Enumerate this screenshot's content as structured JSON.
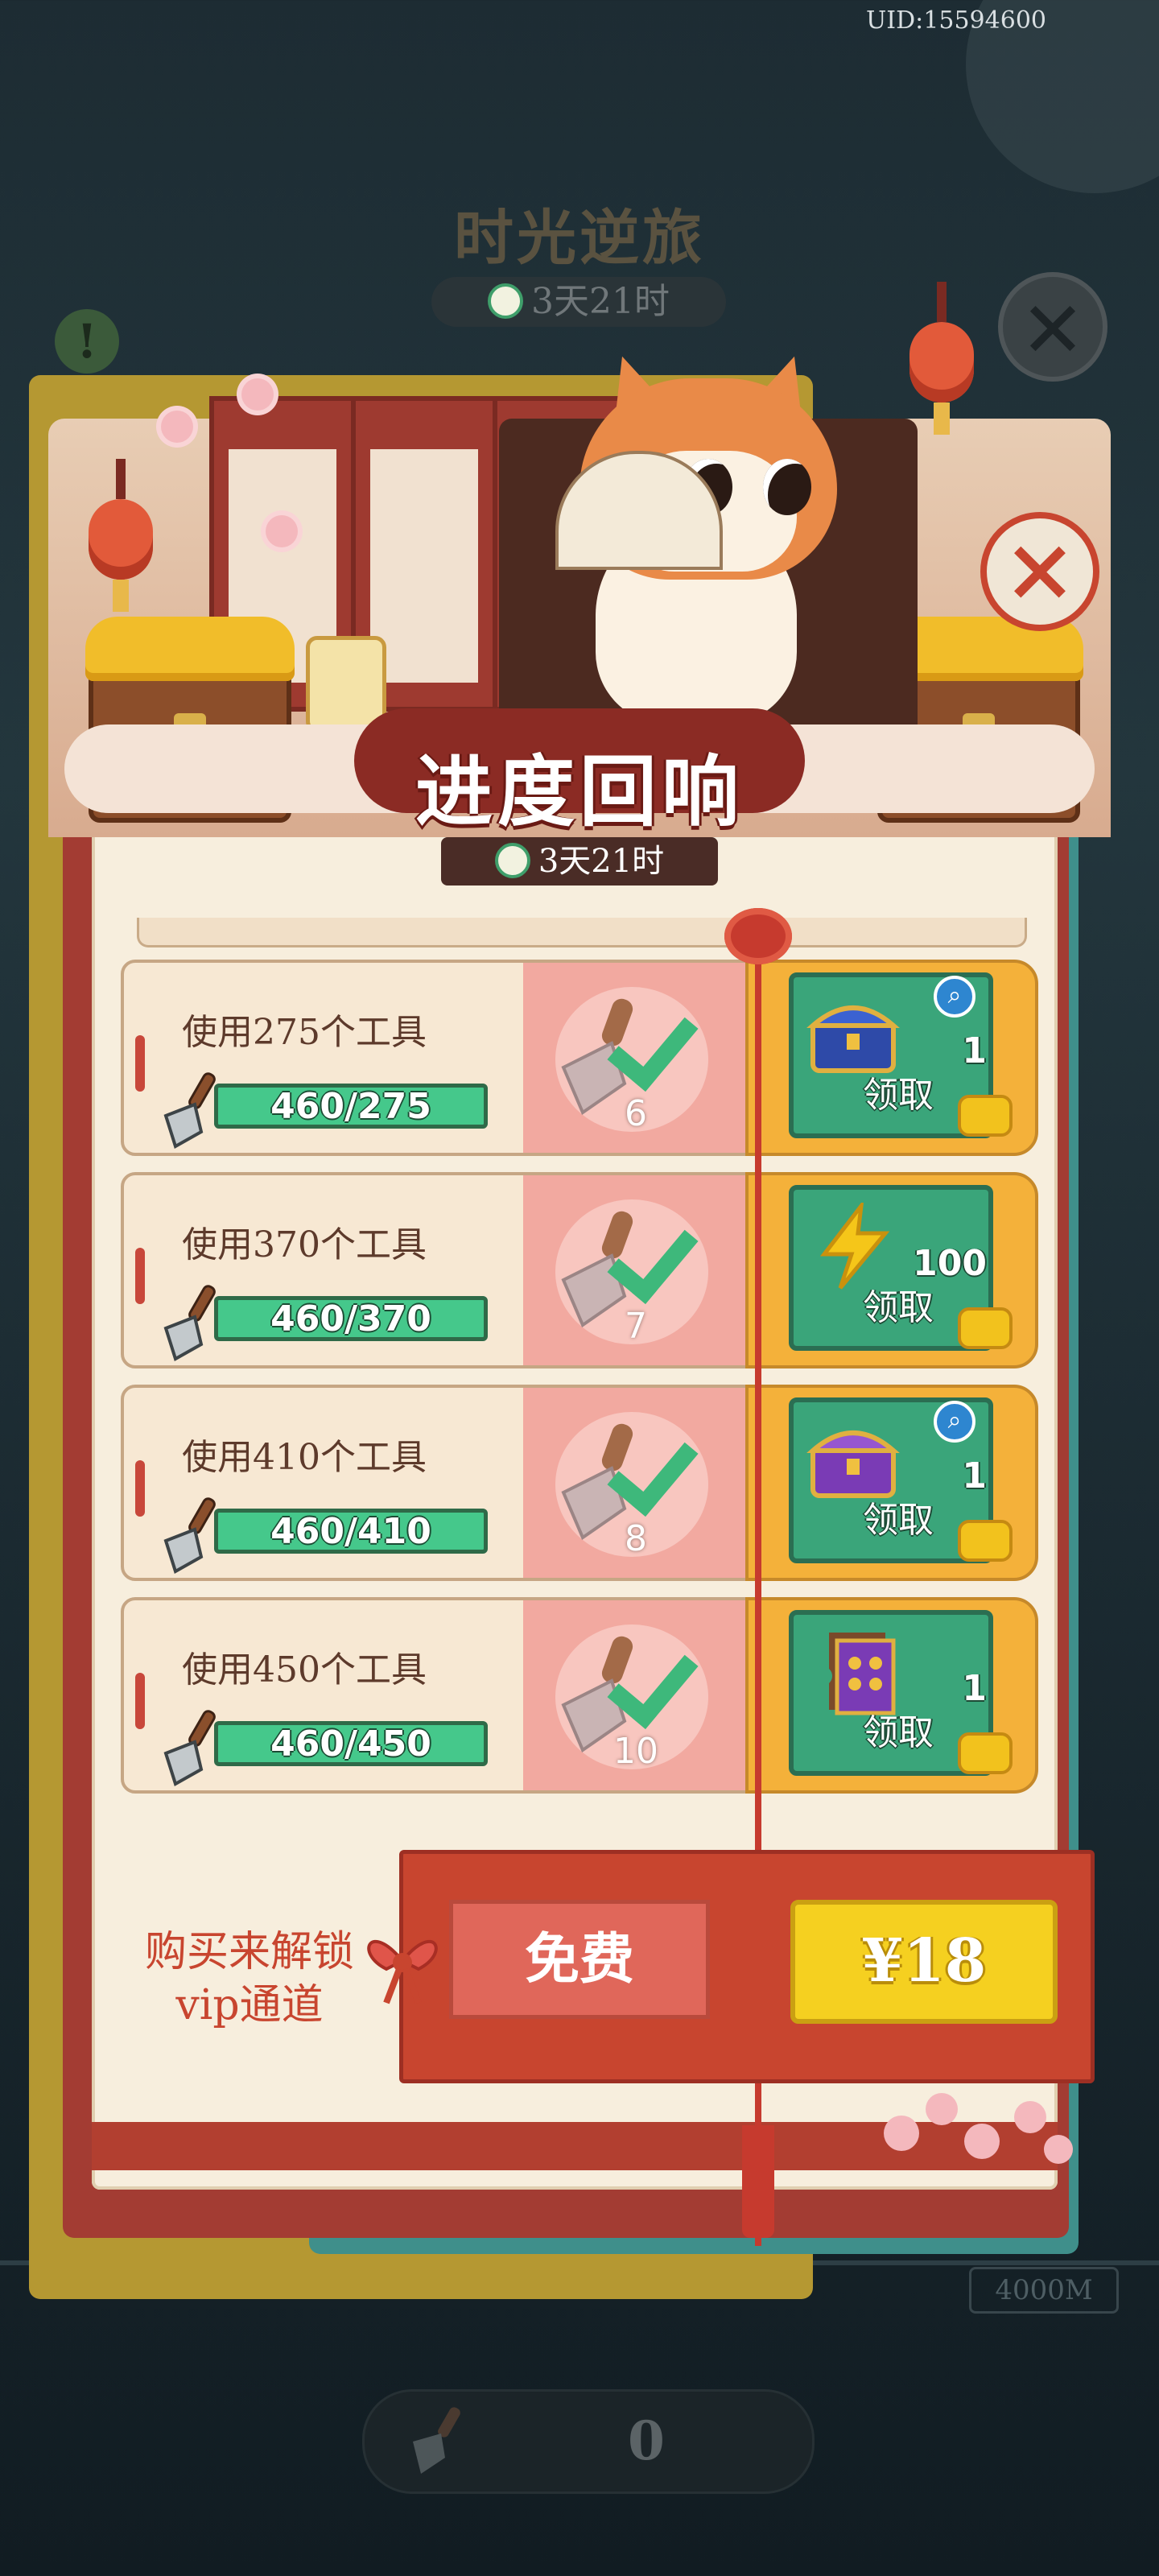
{
  "header": {
    "uid": "UID:15594600",
    "background_event_title": "时光逆旅",
    "background_timer": "3天21时",
    "background_distance": "4000M",
    "background_tool_count": "0"
  },
  "panel": {
    "title": "进度回响",
    "timer": "3天21时",
    "close_icon": "×"
  },
  "rows": [
    {
      "task": "使用275个工具",
      "progress": "460/275",
      "progress_fraction": 1.0,
      "milestone": "6",
      "reward_icon": "blue-treasure-chest-icon",
      "reward_qty": "1",
      "has_magnifier": true,
      "claim_label": "领取"
    },
    {
      "task": "使用370个工具",
      "progress": "460/370",
      "progress_fraction": 1.0,
      "milestone": "7",
      "reward_icon": "lightning-energy-icon",
      "reward_qty": "100",
      "has_magnifier": false,
      "claim_label": "领取"
    },
    {
      "task": "使用410个工具",
      "progress": "460/410",
      "progress_fraction": 1.0,
      "milestone": "8",
      "reward_icon": "purple-treasure-chest-icon",
      "reward_qty": "1",
      "has_magnifier": true,
      "claim_label": "领取"
    },
    {
      "task": "使用450个工具",
      "progress": "460/450",
      "progress_fraction": 1.0,
      "milestone": "10",
      "reward_icon": "purple-scroll-card-icon",
      "reward_qty": "1",
      "has_magnifier": false,
      "claim_label": "领取"
    }
  ],
  "purchase": {
    "unlock_line1": "购买来解锁",
    "unlock_line2": "vip通道",
    "free_label": "免费",
    "price_label": "¥18"
  },
  "colors": {
    "accent_red": "#c8452f",
    "claim_green": "#3aa57a",
    "progress_green": "#45c88b",
    "price_yellow": "#f5d020"
  }
}
